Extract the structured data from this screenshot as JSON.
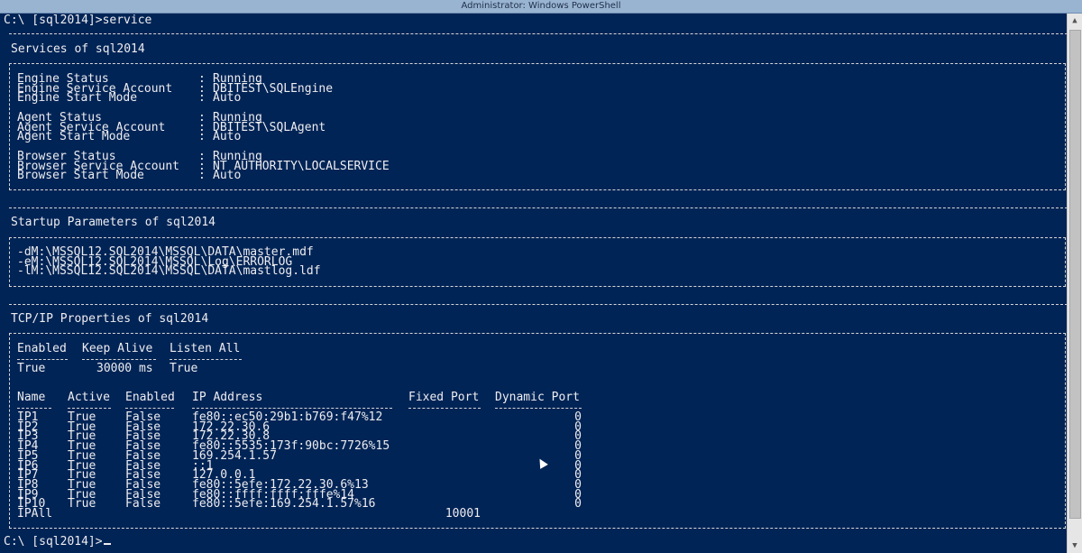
{
  "window": {
    "title": "Administrator: Windows PowerShell"
  },
  "prompts": {
    "top": "C:\\ [sql2014]>service",
    "bottom": "C:\\ [sql2014]>"
  },
  "services": {
    "heading": "Services of sql2014",
    "rows": [
      {
        "label": "Engine Status",
        "value": "Running"
      },
      {
        "label": "Engine Service Account",
        "value": "DBITEST\\SQLEngine"
      },
      {
        "label": "Engine Start Mode",
        "value": "Auto"
      },
      {
        "label": "Agent Status",
        "value": "Running"
      },
      {
        "label": "Agent Service Account",
        "value": "DBITEST\\SQLAgent"
      },
      {
        "label": "Agent Start Mode",
        "value": "Auto"
      },
      {
        "label": "Browser Status",
        "value": "Running"
      },
      {
        "label": "Browser Service Account",
        "value": "NT AUTHORITY\\LOCALSERVICE"
      },
      {
        "label": "Browser Start Mode",
        "value": "Auto"
      }
    ]
  },
  "startup": {
    "heading": "Startup Parameters of sql2014",
    "lines": [
      "-dM:\\MSSQL12.SQL2014\\MSSQL\\DATA\\master.mdf",
      "-eM:\\MSSQL12.SQL2014\\MSSQL\\Log\\ERRORLOG",
      "-lM:\\MSSQL12.SQL2014\\MSSQL\\DATA\\mastlog.ldf"
    ]
  },
  "tcpip": {
    "heading": "TCP/IP Properties of sql2014",
    "props_headers": [
      "Enabled",
      "Keep Alive",
      "Listen All"
    ],
    "props_values": [
      "True",
      "30000 ms",
      "True"
    ],
    "ip_headers": [
      "Name",
      "Active",
      "Enabled",
      "IP Address",
      "Fixed Port",
      "Dynamic Port"
    ],
    "ip_rows": [
      {
        "name": "IP1",
        "active": "True",
        "enabled": "False",
        "ip": "fe80::ec50:29b1:b769:f47%12",
        "fixed": "",
        "dynamic": "0"
      },
      {
        "name": "IP2",
        "active": "True",
        "enabled": "False",
        "ip": "172.22.30.6",
        "fixed": "",
        "dynamic": "0"
      },
      {
        "name": "IP3",
        "active": "True",
        "enabled": "False",
        "ip": "172.22.30.8",
        "fixed": "",
        "dynamic": "0"
      },
      {
        "name": "IP4",
        "active": "True",
        "enabled": "False",
        "ip": "fe80::5535:173f:90bc:7726%15",
        "fixed": "",
        "dynamic": "0"
      },
      {
        "name": "IP5",
        "active": "True",
        "enabled": "False",
        "ip": "169.254.1.57",
        "fixed": "",
        "dynamic": "0"
      },
      {
        "name": "IP6",
        "active": "True",
        "enabled": "False",
        "ip": "::1",
        "fixed": "",
        "dynamic": "0"
      },
      {
        "name": "IP7",
        "active": "True",
        "enabled": "False",
        "ip": "127.0.0.1",
        "fixed": "",
        "dynamic": "0"
      },
      {
        "name": "IP8",
        "active": "True",
        "enabled": "False",
        "ip": "fe80::5efe:172.22.30.6%13",
        "fixed": "",
        "dynamic": "0"
      },
      {
        "name": "IP9",
        "active": "True",
        "enabled": "False",
        "ip": "fe80::ffff:ffff:fffe%14",
        "fixed": "",
        "dynamic": "0"
      },
      {
        "name": "IP10",
        "active": "True",
        "enabled": "False",
        "ip": "fe80::5efe:169.254.1.57%16",
        "fixed": "",
        "dynamic": "0"
      },
      {
        "name": "IPAll",
        "active": "",
        "enabled": "",
        "ip": "",
        "fixed": "10001",
        "dynamic": ""
      }
    ]
  },
  "colors": {
    "background": "#012456",
    "text": "#eeedf0"
  },
  "icons": {
    "scroll_up": "triangle-up",
    "scroll_down": "triangle-down",
    "pointer": "mouse-pointer"
  }
}
